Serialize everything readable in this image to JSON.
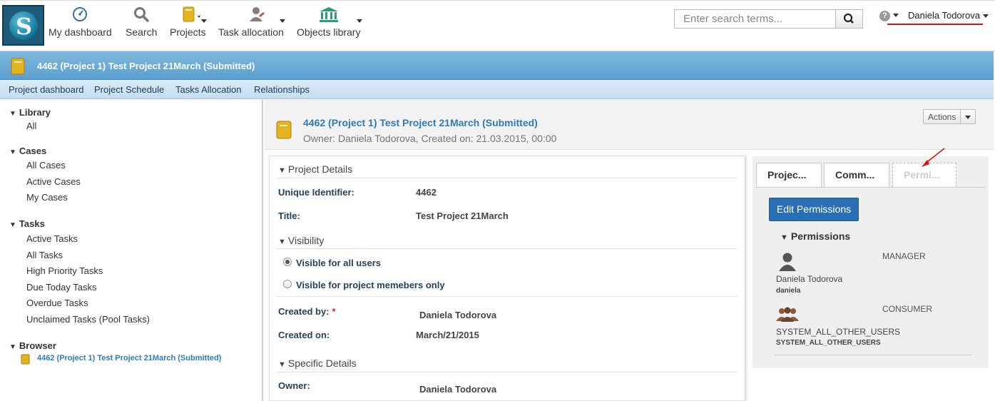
{
  "nav": {
    "items": [
      {
        "label": "My dashboard",
        "icon": "dashboard-icon"
      },
      {
        "label": "Search",
        "icon": "search-icon"
      },
      {
        "label": "Projects",
        "icon": "project-icon"
      },
      {
        "label": "Task allocation",
        "icon": "user-task-icon"
      },
      {
        "label": "Objects library",
        "icon": "library-icon"
      }
    ],
    "search_placeholder": "Enter search terms...",
    "user_name": "Daniela Todorova",
    "help": "?"
  },
  "title_band": {
    "title": "4462 (Project 1) Test Project 21March (Submitted)"
  },
  "subnav": [
    "Project dashboard",
    "Project Schedule",
    "Tasks Allocation",
    "Relationships"
  ],
  "sidebar": {
    "library": {
      "title": "Library",
      "items": [
        "All"
      ]
    },
    "cases": {
      "title": "Cases",
      "items": [
        "All Cases",
        "Active Cases",
        "My Cases"
      ]
    },
    "tasks": {
      "title": "Tasks",
      "items": [
        "Active Tasks",
        "All Tasks",
        "High Priority Tasks",
        "Due Today Tasks",
        "Overdue Tasks",
        "Unclaimed Tasks (Pool Tasks)"
      ]
    },
    "browser": {
      "title": "Browser",
      "item": "4462 (Project 1) Test Project 21March (Submitted)"
    }
  },
  "header": {
    "title": "4462 (Project 1) Test Project 21March (Submitted)",
    "subtitle": "Owner: Daniela Todorova, Created on: 21.03.2015, 00:00",
    "actions_label": "Actions"
  },
  "details": {
    "project_details": "Project Details",
    "unique_id_label": "Unique Identifier:",
    "unique_id_value": "4462",
    "title_label": "Title:",
    "title_value": "Test Project 21March",
    "visibility": "Visibility",
    "visible_all": "Visible for all users",
    "visible_members": "Visible for project memebers only",
    "created_by_label": "Created by:",
    "required_mark": "*",
    "created_by_value": "Daniela Todorova",
    "created_on_label": "Created on:",
    "created_on_value": "March/21/2015",
    "specific_details": "Specific Details",
    "owner_label": "Owner:",
    "owner_value": "Daniela Todorova"
  },
  "right": {
    "tabs": [
      "Projec...",
      "Comm...",
      "Permi..."
    ],
    "edit_button": "Edit Permissions",
    "permissions_title": "Permissions",
    "entries": [
      {
        "role": "MANAGER",
        "name": "Daniela Todorova",
        "sub": "daniela",
        "icon": "user-icon"
      },
      {
        "role": "CONSUMER",
        "name": "SYSTEM_ALL_OTHER_USERS",
        "sub": "SYSTEM_ALL_OTHER_USERS",
        "icon": "group-icon"
      }
    ]
  },
  "colors": {
    "accent": "#2a6fb4",
    "title_band": "#5b9fcf",
    "link": "#2f7ab9",
    "annotation": "#dd1111"
  }
}
